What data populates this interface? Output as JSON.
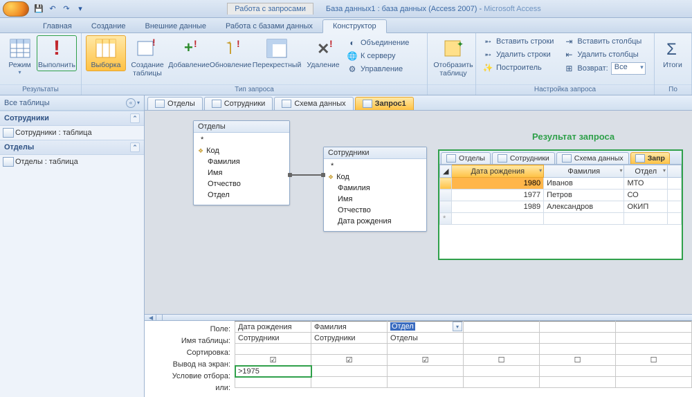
{
  "title": {
    "context_tab": "Работа с запросами",
    "doc": "База данных1 : база данных (Access 2007) - ",
    "app": "Microsoft Access"
  },
  "ribbon_tabs": [
    "Главная",
    "Создание",
    "Внешние данные",
    "Работа с базами данных",
    "Конструктор"
  ],
  "ribbon": {
    "grp_results": "Результаты",
    "btn_view": "Режим",
    "btn_run": "Выполнить",
    "grp_qtype": "Тип запроса",
    "btn_select": "Выборка",
    "btn_maketable": "Создание таблицы",
    "btn_append": "Добавление",
    "btn_update": "Обновление",
    "btn_crosstab": "Перекрестный",
    "btn_delete": "Удаление",
    "btn_union": "Объединение",
    "btn_passthru": "К серверу",
    "btn_ddl": "Управление",
    "grp_show": "",
    "btn_showtable": "Отобразить таблицу",
    "grp_setup": "Настройка запроса",
    "ins_rows": "Вставить строки",
    "del_rows": "Удалить строки",
    "builder": "Построитель",
    "ins_cols": "Вставить столбцы",
    "del_cols": "Удалить столбцы",
    "return_lbl": "Возврат:",
    "return_val": "Все",
    "grp_totals": "Итоги",
    "grp_last": "По"
  },
  "nav": {
    "header": "Все таблицы",
    "g1": "Сотрудники",
    "g1_item": "Сотрудники : таблица",
    "g2": "Отделы",
    "g2_item": "Отделы : таблица"
  },
  "doctabs": [
    "Отделы",
    "Сотрудники",
    "Схема данных",
    "Запрос1"
  ],
  "tables": {
    "t1": {
      "title": "Отделы",
      "fields": [
        "*",
        "Код",
        "Фамилия",
        "Имя",
        "Отчество",
        "Отдел"
      ],
      "pk": 1
    },
    "t2": {
      "title": "Сотрудники",
      "fields": [
        "*",
        "Код",
        "Фамилия",
        "Имя",
        "Отчество",
        "Дата рождения"
      ],
      "pk": 1
    }
  },
  "result": {
    "heading": "Результат запроса",
    "cols": [
      "Дата рождения",
      "Фамилия",
      "Отдел"
    ],
    "rows": [
      {
        "y": "1980",
        "f": "Иванов",
        "o": "МТО"
      },
      {
        "y": "1977",
        "f": "Петров",
        "o": "СО"
      },
      {
        "y": "1989",
        "f": "Александров",
        "o": "ОКИП"
      }
    ]
  },
  "qbe": {
    "labels": [
      "Поле:",
      "Имя таблицы:",
      "Сортировка:",
      "Вывод на экран:",
      "Условие отбора:",
      "или:"
    ],
    "cols": [
      {
        "field": "Дата рождения",
        "table": "Сотрудники",
        "show": true,
        "crit": ">1975"
      },
      {
        "field": "Фамилия",
        "table": "Сотрудники",
        "show": true,
        "crit": ""
      },
      {
        "field": "Отдел",
        "table": "Отделы",
        "show": true,
        "crit": "",
        "sel": true
      },
      {
        "field": "",
        "table": "",
        "show": false,
        "crit": ""
      },
      {
        "field": "",
        "table": "",
        "show": false,
        "crit": ""
      },
      {
        "field": "",
        "table": "",
        "show": false,
        "crit": ""
      }
    ]
  }
}
